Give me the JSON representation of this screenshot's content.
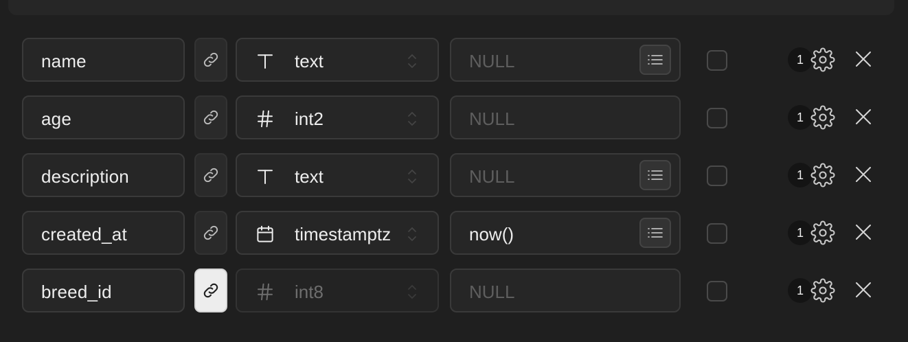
{
  "columns": [
    {
      "name": "name",
      "type": "text",
      "type_icon": "text-type-icon",
      "default": "NULL",
      "default_is_placeholder": true,
      "has_suggestions_button": true,
      "foreign_key_active": false,
      "badge": "1"
    },
    {
      "name": "age",
      "type": "int2",
      "type_icon": "hash-icon",
      "default": "NULL",
      "default_is_placeholder": true,
      "has_suggestions_button": false,
      "foreign_key_active": false,
      "badge": "1"
    },
    {
      "name": "description",
      "type": "text",
      "type_icon": "text-type-icon",
      "default": "NULL",
      "default_is_placeholder": true,
      "has_suggestions_button": true,
      "foreign_key_active": false,
      "badge": "1"
    },
    {
      "name": "created_at",
      "type": "timestamptz",
      "type_icon": "calendar-icon",
      "default": "now()",
      "default_is_placeholder": false,
      "has_suggestions_button": true,
      "foreign_key_active": false,
      "badge": "1"
    },
    {
      "name": "breed_id",
      "type": "int8",
      "type_icon": "hash-icon",
      "default": "NULL",
      "default_is_placeholder": true,
      "has_suggestions_button": false,
      "foreign_key_active": true,
      "type_disabled": true,
      "badge": "1"
    }
  ],
  "colors": {
    "background": "#1f1f1f",
    "field_background": "#262626",
    "border": "#3a3a3a",
    "text": "#ededed",
    "placeholder": "#5e5e5e",
    "active_link_button": "#ededed"
  }
}
